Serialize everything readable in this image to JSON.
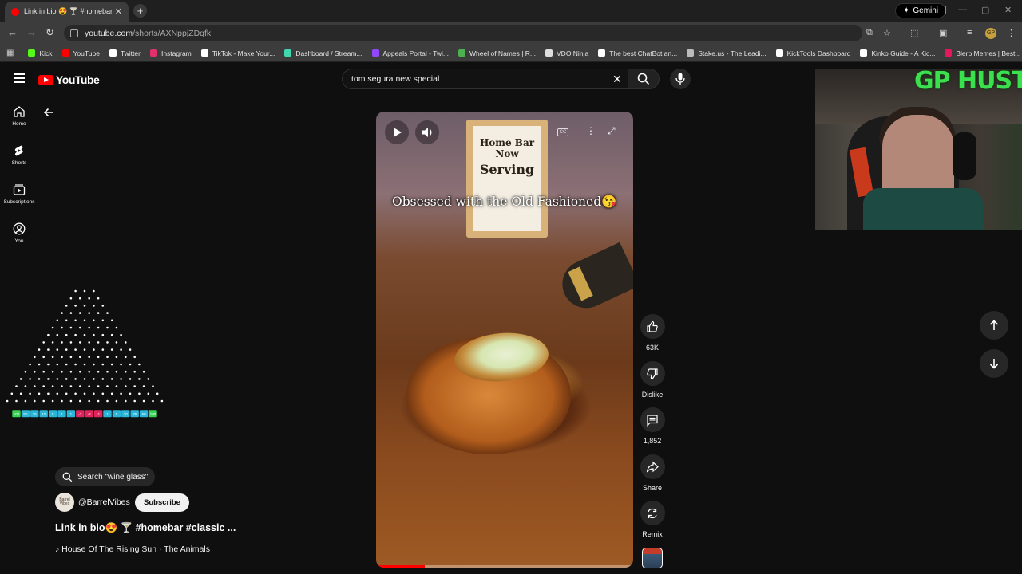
{
  "browser": {
    "tab_title": "Link in bio 😍 🍸 #homebar #cla",
    "tab_close": "✕",
    "new_tab": "+",
    "gemini_label": "Gemini",
    "url_host": "youtube.com",
    "url_path": "/shorts/AXNppjZDqfk",
    "bookmarks": [
      {
        "label": "Kick",
        "color": "#53fc18"
      },
      {
        "label": "YouTube",
        "color": "#ff0000"
      },
      {
        "label": "Twitter",
        "color": "#ffffff"
      },
      {
        "label": "Instagram",
        "color": "#e1306c"
      },
      {
        "label": "TikTok - Make Your...",
        "color": "#ffffff"
      },
      {
        "label": "Dashboard / Stream...",
        "color": "#3fd6b0"
      },
      {
        "label": "Appeals Portal - Twi...",
        "color": "#9146ff"
      },
      {
        "label": "Wheel of Names | R...",
        "color": "#4caf50"
      },
      {
        "label": "VDO.Ninja",
        "color": "#dddddd"
      },
      {
        "label": "The best ChatBot an...",
        "color": "#ffffff"
      },
      {
        "label": "Stake.us - The Leadi...",
        "color": "#bbbbbb"
      },
      {
        "label": "KickTools Dashboard",
        "color": "#ffffff"
      },
      {
        "label": "Kinko Guide - A Kic...",
        "color": "#ffffff"
      },
      {
        "label": "Blerp Memes | Best...",
        "color": "#e8175d"
      }
    ]
  },
  "youtube": {
    "logo_text": "YouTube",
    "search_value": "tom segura new special",
    "sidebar": [
      {
        "label": "Home",
        "icon": "home-icon"
      },
      {
        "label": "Shorts",
        "icon": "shorts-icon"
      },
      {
        "label": "Subscriptions",
        "icon": "subscriptions-icon"
      },
      {
        "label": "You",
        "icon": "you-icon"
      }
    ],
    "search_hint": "Search \"wine glass\"",
    "channel": {
      "avatar_text": "Barrel Vibes",
      "handle": "@BarrelVibes",
      "subscribe_label": "Subscribe"
    },
    "video_title": "Link in bio😍 🍸 #homebar #classic ...",
    "music": "♪ House Of The Rising Sun · The Animals",
    "video": {
      "overlay_text": "Obsessed with the Old Fashioned😘",
      "sign_line1": "Home Bar",
      "sign_line2": "Now",
      "sign_line3": "Serving",
      "cc_text": "CC",
      "progress": 0.19
    },
    "actions": {
      "like_count": "63K",
      "dislike_label": "Dislike",
      "comment_count": "1,852",
      "share_label": "Share",
      "remix_label": "Remix"
    }
  },
  "stream_overlay": {
    "plinko_slots": [
      "100",
      "50",
      "25",
      "10",
      "5",
      "1",
      "1",
      "-1",
      "-2",
      "-1",
      "1",
      "5",
      "10",
      "25",
      "50",
      "100"
    ],
    "slot_colors": [
      "#39d353",
      "#2bb5d8",
      "#2bb5d8",
      "#2bb5d8",
      "#2bb5d8",
      "#2bb5d8",
      "#2bb5d8",
      "#e0245e",
      "#e0245e",
      "#e0245e",
      "#2bb5d8",
      "#2bb5d8",
      "#2bb5d8",
      "#2bb5d8",
      "#2bb5d8",
      "#39d353"
    ],
    "webcam_text": "GP HUSTLA"
  }
}
